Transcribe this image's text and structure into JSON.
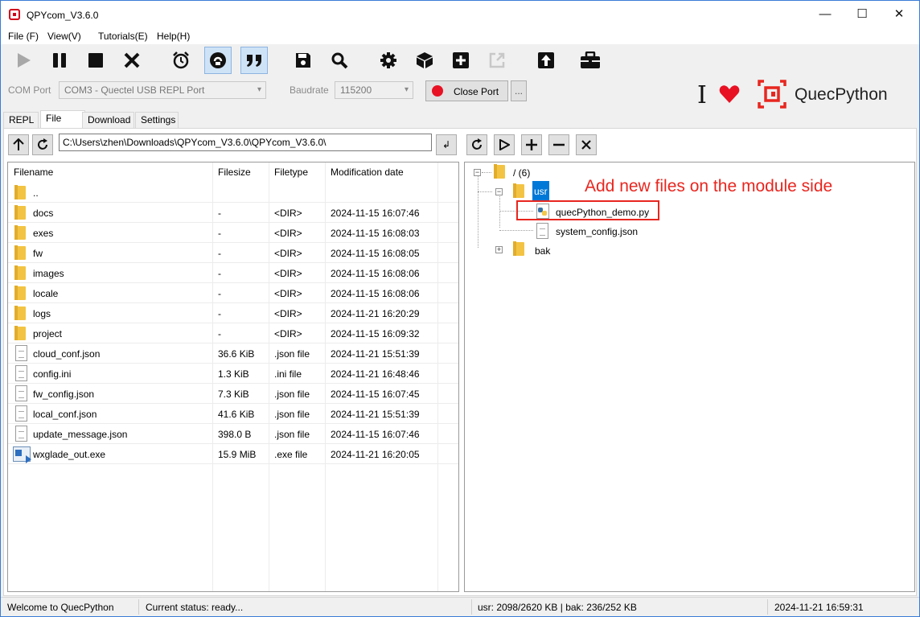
{
  "window": {
    "title": "QPYcom_V3.6.0"
  },
  "menu": [
    "File (F)",
    "View(V)",
    "Tutorials(E)",
    "Help(H)"
  ],
  "toolbar_icons": [
    "play-icon",
    "pause-icon",
    "stop-icon",
    "close-icon",
    "alarm-icon",
    "sync-icon",
    "quote-icon",
    "save-icon",
    "search-icon",
    "gear-icon",
    "cube-icon",
    "plus-icon",
    "export-icon",
    "upload-icon",
    "toolbox-icon"
  ],
  "com": {
    "port_label": "COM Port",
    "port_value": "COM3 - Quectel USB REPL Port",
    "baud_label": "Baudrate",
    "baud_value": "115200",
    "close_port_label": "Close Port",
    "more_label": "...",
    "status_dot_color": "#e81123"
  },
  "brand": {
    "cursor": "I",
    "heart_color": "#e81123",
    "name": "QuecPython",
    "accent": "#e8261f"
  },
  "tabs": [
    "REPL",
    "File",
    "Download",
    "Settings"
  ],
  "left": {
    "path": "C:\\Users\\zhen\\Downloads\\QPYcom_V3.6.0\\QPYcom_V3.6.0\\",
    "enter_glyph": "↲",
    "columns": [
      "Filename",
      "Filesize",
      "Filetype",
      "Modification date"
    ],
    "rows": [
      {
        "icon": "folder",
        "name": "..",
        "size": "",
        "type": "",
        "date": ""
      },
      {
        "icon": "folder",
        "name": "docs",
        "size": "-",
        "type": "<DIR>",
        "date": "2024-11-15 16:07:46"
      },
      {
        "icon": "folder",
        "name": "exes",
        "size": "-",
        "type": "<DIR>",
        "date": "2024-11-15 16:08:03"
      },
      {
        "icon": "folder",
        "name": "fw",
        "size": "-",
        "type": "<DIR>",
        "date": "2024-11-15 16:08:05"
      },
      {
        "icon": "folder",
        "name": "images",
        "size": "-",
        "type": "<DIR>",
        "date": "2024-11-15 16:08:06"
      },
      {
        "icon": "folder",
        "name": "locale",
        "size": "-",
        "type": "<DIR>",
        "date": "2024-11-15 16:08:06"
      },
      {
        "icon": "folder",
        "name": "logs",
        "size": "-",
        "type": "<DIR>",
        "date": "2024-11-21 16:20:29"
      },
      {
        "icon": "folder",
        "name": "project",
        "size": "-",
        "type": "<DIR>",
        "date": "2024-11-15 16:09:32"
      },
      {
        "icon": "file",
        "name": "cloud_conf.json",
        "size": "36.6 KiB",
        "type": ".json file",
        "date": "2024-11-21 15:51:39"
      },
      {
        "icon": "file",
        "name": "config.ini",
        "size": "1.3 KiB",
        "type": ".ini file",
        "date": "2024-11-21 16:48:46"
      },
      {
        "icon": "file",
        "name": "fw_config.json",
        "size": "7.3 KiB",
        "type": ".json file",
        "date": "2024-11-15 16:07:45"
      },
      {
        "icon": "file",
        "name": "local_conf.json",
        "size": "41.6 KiB",
        "type": ".json file",
        "date": "2024-11-21 15:51:39"
      },
      {
        "icon": "file",
        "name": "update_message.json",
        "size": "398.0 B",
        "type": ".json file",
        "date": "2024-11-15 16:07:46"
      },
      {
        "icon": "exe",
        "name": "wxglade_out.exe",
        "size": "15.9 MiB",
        "type": ".exe file",
        "date": "2024-11-21 16:20:05"
      }
    ]
  },
  "tree": {
    "root": "/ (6)",
    "usr": "usr",
    "file1": "quecPython_demo.py",
    "file2": "system_config.json",
    "bak": "bak"
  },
  "annotation": "Add new files on the module side",
  "status": {
    "welcome": "Welcome to QuecPython",
    "current": "Current status: ready...",
    "storage": "usr: 2098/2620 KB | bak: 236/252 KB",
    "time": "2024-11-21 16:59:31"
  }
}
